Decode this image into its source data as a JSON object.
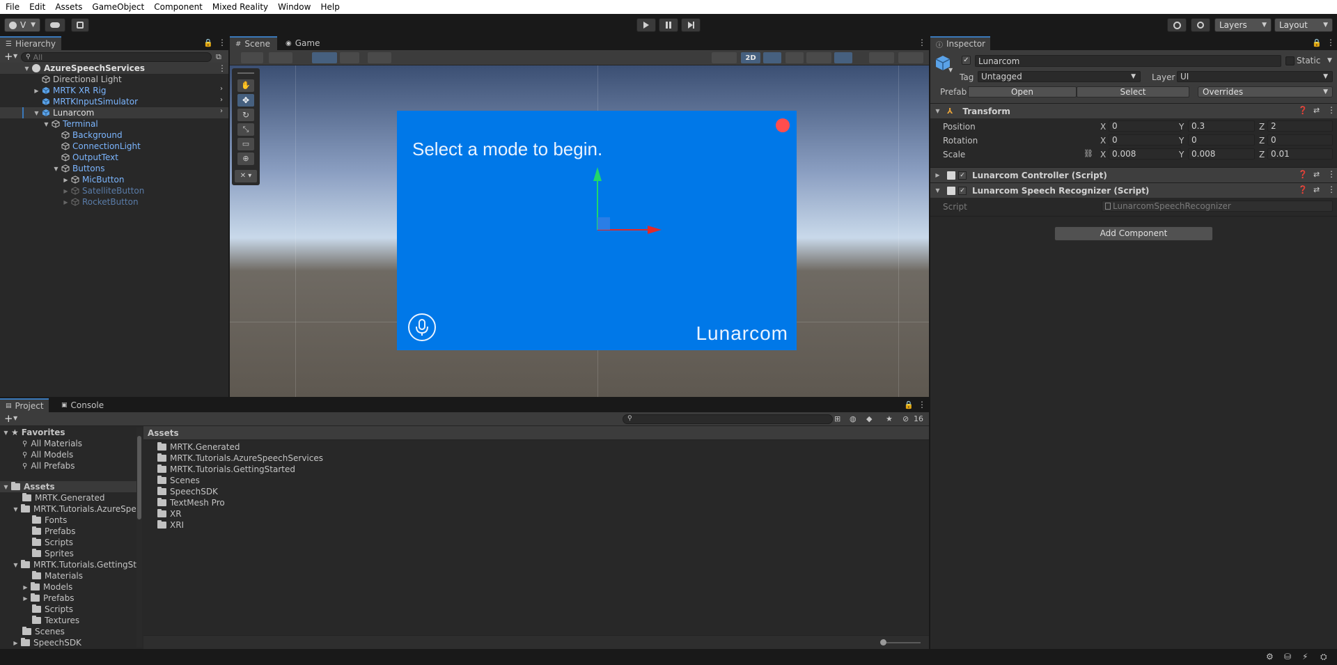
{
  "menu": [
    "File",
    "Edit",
    "Assets",
    "GameObject",
    "Component",
    "Mixed Reality",
    "Window",
    "Help"
  ],
  "toolbar": {
    "account": "V",
    "layers": "Layers",
    "layout": "Layout"
  },
  "hierarchy": {
    "tab": "Hierarchy",
    "search_placeholder": "All",
    "items": [
      {
        "label": "AzureSpeechServices",
        "indent": 0
      },
      {
        "label": "Directional Light",
        "indent": 1
      },
      {
        "label": "MRTK XR Rig",
        "indent": 1
      },
      {
        "label": "MRTKInputSimulator",
        "indent": 1
      },
      {
        "label": "Lunarcom",
        "indent": 1
      },
      {
        "label": "Terminal",
        "indent": 2
      },
      {
        "label": "Background",
        "indent": 3
      },
      {
        "label": "ConnectionLight",
        "indent": 3
      },
      {
        "label": "OutputText",
        "indent": 3
      },
      {
        "label": "Buttons",
        "indent": 3
      },
      {
        "label": "MicButton",
        "indent": 4
      },
      {
        "label": "SatelliteButton",
        "indent": 4
      },
      {
        "label": "RocketButton",
        "indent": 4
      }
    ]
  },
  "scene": {
    "tabs": [
      "Scene",
      "Game"
    ],
    "toggle_2d": "2D",
    "panel_text": "Select a mode to begin.",
    "brand": "Lunarcom"
  },
  "inspector": {
    "tab": "Inspector",
    "object_name": "Lunarcom",
    "static_label": "Static",
    "tag_label": "Tag",
    "tag_value": "Untagged",
    "layer_label": "Layer",
    "layer_value": "UI",
    "prefab_label": "Prefab",
    "prefab_open": "Open",
    "prefab_select": "Select",
    "prefab_overrides": "Overrides",
    "transform": {
      "title": "Transform",
      "position_label": "Position",
      "rotation_label": "Rotation",
      "scale_label": "Scale",
      "axis_x": "X",
      "axis_y": "Y",
      "axis_z": "Z",
      "position": [
        "0",
        "0.3",
        "2"
      ],
      "rotation": [
        "0",
        "0",
        "0"
      ],
      "scale": [
        "0.008",
        "0.008",
        "0.01"
      ]
    },
    "controller_title": "Lunarcom Controller (Script)",
    "recognizer_title": "Lunarcom Speech Recognizer (Script)",
    "script_label": "Script",
    "script_value": "LunarcomSpeechRecognizer",
    "add_component": "Add Component"
  },
  "project": {
    "tabs": [
      "Project",
      "Console"
    ],
    "hidden_count": "16",
    "favorites": {
      "label": "Favorites",
      "items": [
        "All Materials",
        "All Models",
        "All Prefabs"
      ]
    },
    "tree": [
      {
        "label": "Assets",
        "indent": 0
      },
      {
        "label": "MRTK.Generated",
        "indent": 1
      },
      {
        "label": "MRTK.Tutorials.AzureSpe",
        "indent": 1
      },
      {
        "label": "Fonts",
        "indent": 2
      },
      {
        "label": "Prefabs",
        "indent": 2
      },
      {
        "label": "Scripts",
        "indent": 2
      },
      {
        "label": "Sprites",
        "indent": 2
      },
      {
        "label": "MRTK.Tutorials.GettingSta",
        "indent": 1
      },
      {
        "label": "Materials",
        "indent": 2
      },
      {
        "label": "Models",
        "indent": 2
      },
      {
        "label": "Prefabs",
        "indent": 2
      },
      {
        "label": "Scripts",
        "indent": 2
      },
      {
        "label": "Textures",
        "indent": 2
      },
      {
        "label": "Scenes",
        "indent": 1
      },
      {
        "label": "SpeechSDK",
        "indent": 1
      }
    ],
    "breadcrumb": "Assets",
    "assets": [
      "MRTK.Generated",
      "MRTK.Tutorials.AzureSpeechServices",
      "MRTK.Tutorials.GettingStarted",
      "Scenes",
      "SpeechSDK",
      "TextMesh Pro",
      "XR",
      "XRI"
    ]
  },
  "colors": {
    "accent": "#3a79bb",
    "panel_blue": "#0078e8",
    "selected_row": "#2c5d87"
  }
}
